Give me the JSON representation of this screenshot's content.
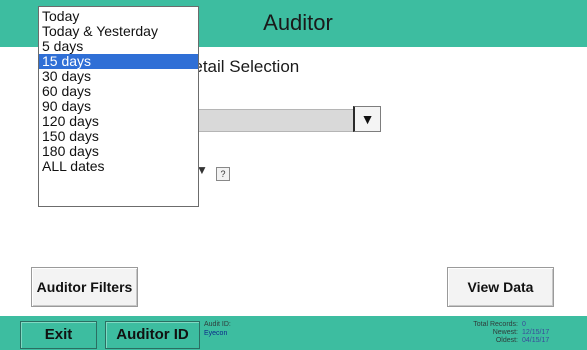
{
  "header": {
    "title": "Auditor"
  },
  "main": {
    "subtitle": "rt Detail Selection",
    "combo_arrow": "▼",
    "small_arrow": "▼",
    "help_label": "?"
  },
  "dropdown": {
    "selected_index": 3,
    "options": [
      "Today",
      "Today & Yesterday",
      "5 days",
      "15 days",
      "30 days",
      "60 days",
      "90 days",
      "120 days",
      "150 days",
      "180 days",
      "ALL dates"
    ]
  },
  "buttons": {
    "auditor_filters": "Auditor Filters",
    "view_data": "View Data",
    "exit": "Exit",
    "auditor_id": "Auditor ID"
  },
  "status": {
    "audit_id_label": "Audit ID:",
    "audit_id_value": "Eyecon",
    "total_records_label": "Total Records:",
    "total_records_value": "0",
    "newest_label": "Newest:",
    "newest_value": "12/15/17",
    "oldest_label": "Oldest:",
    "oldest_value": "04/15/17"
  },
  "colors": {
    "teal": "#3dbda0",
    "selection": "#2f6fd6"
  }
}
